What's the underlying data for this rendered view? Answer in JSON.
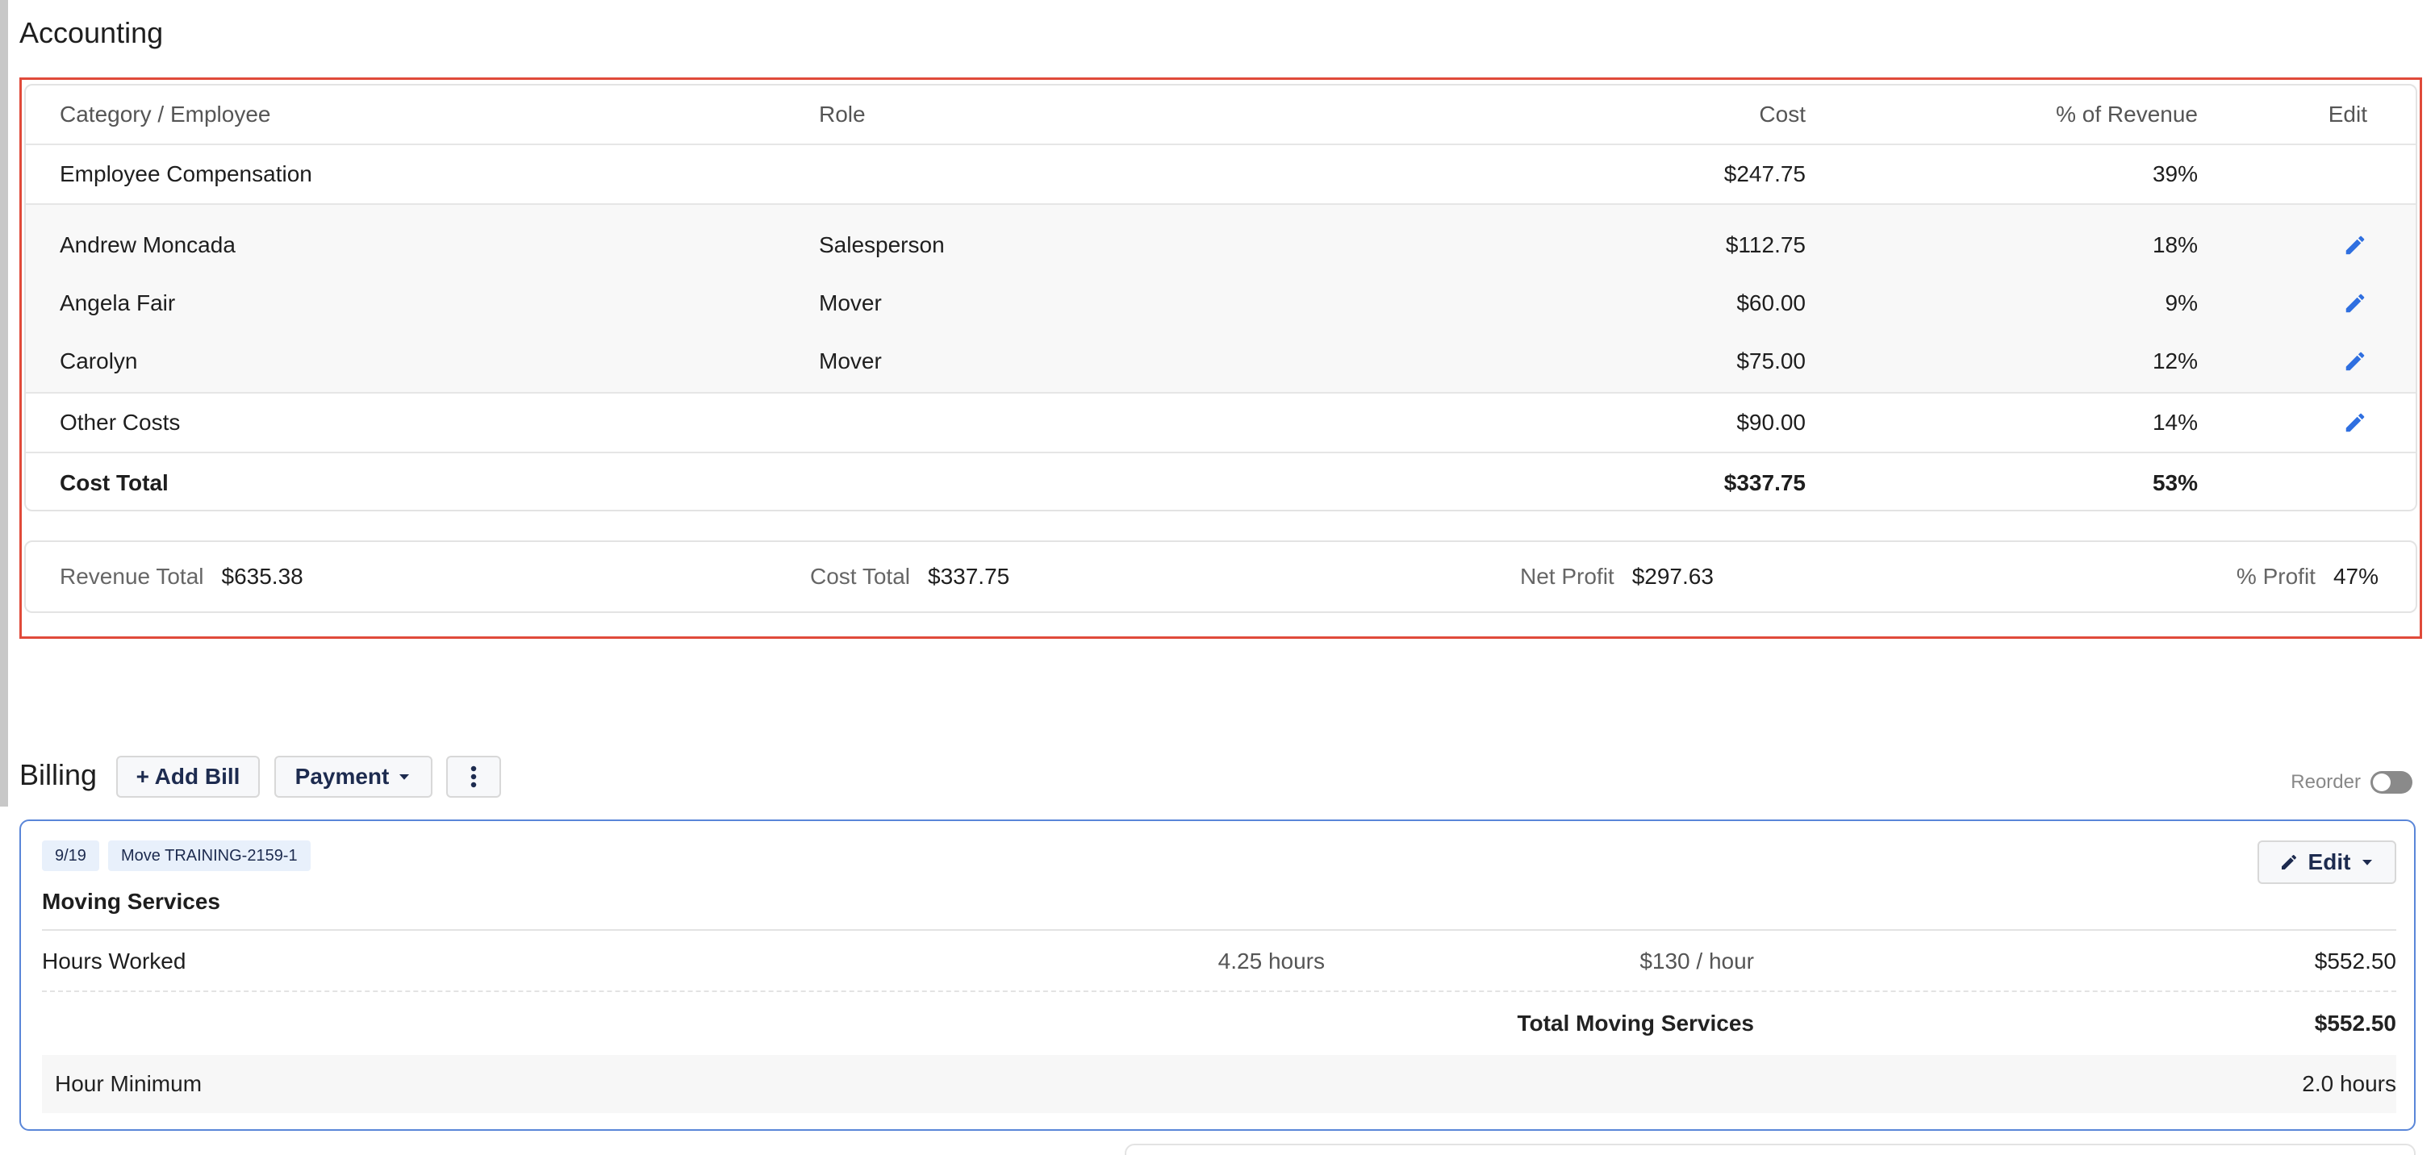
{
  "accounting": {
    "title": "Accounting",
    "columns": {
      "name": "Category / Employee",
      "role": "Role",
      "cost": "Cost",
      "pct": "% of Revenue",
      "edit": "Edit"
    },
    "employee_compensation": {
      "name": "Employee Compensation",
      "cost": "$247.75",
      "pct": "39%"
    },
    "employees": [
      {
        "name": "Andrew Moncada",
        "role": "Salesperson",
        "cost": "$112.75",
        "pct": "18%"
      },
      {
        "name": "Angela Fair",
        "role": "Mover",
        "cost": "$60.00",
        "pct": "9%"
      },
      {
        "name": "Carolyn",
        "role": "Mover",
        "cost": "$75.00",
        "pct": "12%"
      }
    ],
    "other_costs": {
      "name": "Other Costs",
      "cost": "$90.00",
      "pct": "14%"
    },
    "cost_total": {
      "name": "Cost Total",
      "cost": "$337.75",
      "pct": "53%"
    },
    "summary": {
      "revenue_label": "Revenue Total",
      "revenue_value": "$635.38",
      "cost_label": "Cost Total",
      "cost_value": "$337.75",
      "net_label": "Net Profit",
      "net_value": "$297.63",
      "pct_label": "% Profit",
      "pct_value": "47%"
    }
  },
  "billing": {
    "title": "Billing",
    "add_bill_label": "+ Add Bill",
    "payment_label": "Payment",
    "reorder_label": "Reorder",
    "bill": {
      "date_tag": "9/19",
      "move_tag": "Move TRAINING-2159-1",
      "edit_label": "Edit",
      "service_name": "Moving Services",
      "line": {
        "name": "Hours Worked",
        "qty": "4.25 hours",
        "rate": "$130 / hour",
        "amount": "$552.50"
      },
      "total_label": "Total Moving Services",
      "total_amount": "$552.50",
      "minimum_label": "Hour Minimum",
      "minimum_value": "2.0 hours"
    }
  },
  "colors": {
    "highlight": "#e04a3a",
    "pencil": "#2f6fe0",
    "card_border": "#5a86d8",
    "tag_bg": "#e8f0fb",
    "button_text": "#1d2b4f"
  },
  "icons": {
    "edit": "pencil-icon",
    "dropdown": "caret-down-icon",
    "more": "vertical-dots-icon"
  }
}
